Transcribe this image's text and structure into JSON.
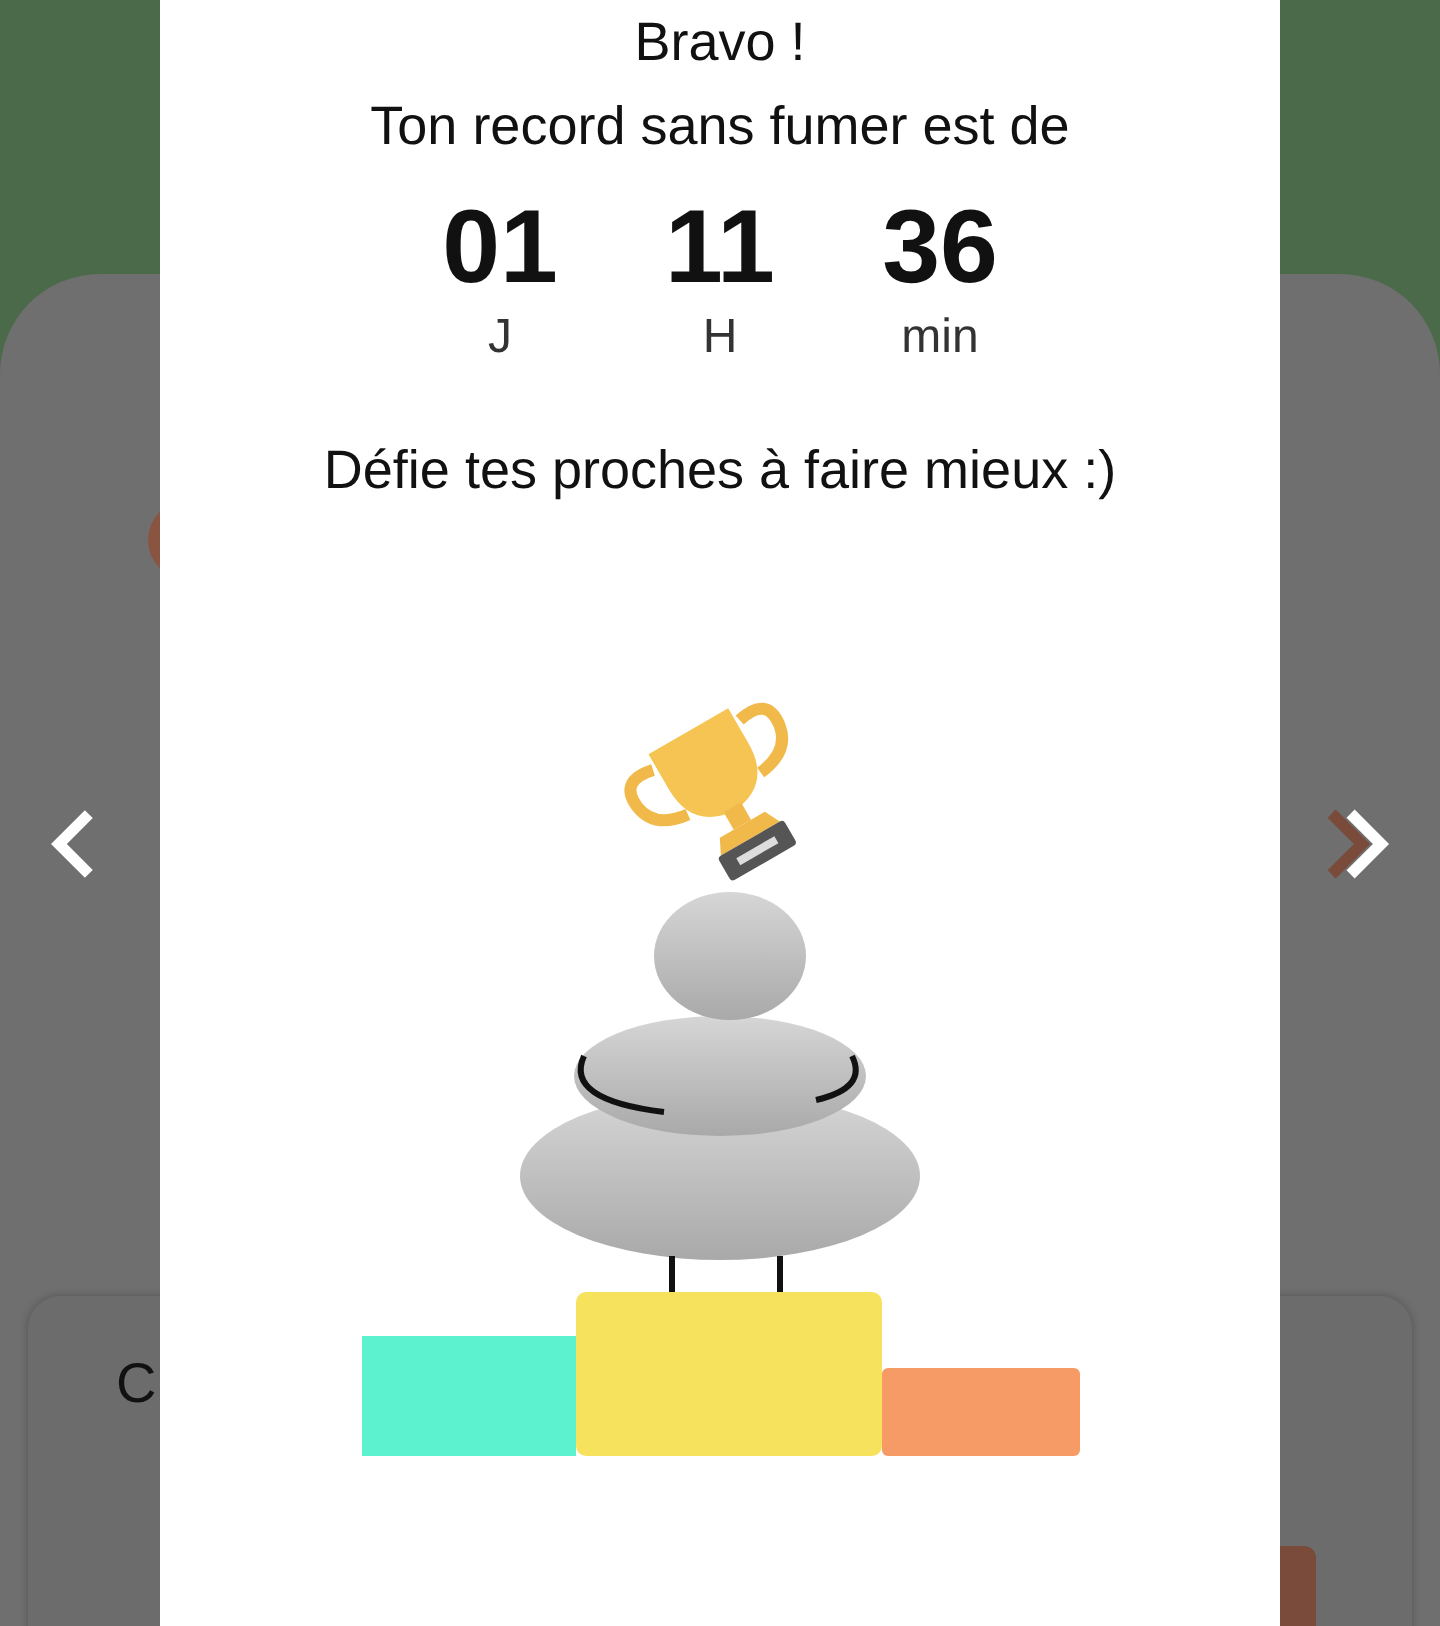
{
  "background": {
    "card_title": "C"
  },
  "dialog": {
    "title": "Bravo !",
    "subtitle": "Ton record sans fumer est de",
    "record": [
      {
        "value": "01",
        "unit": "J"
      },
      {
        "value": "11",
        "unit": "H"
      },
      {
        "value": "36",
        "unit": "min"
      }
    ],
    "challenge": "Défie tes proches à faire mieux :)"
  }
}
